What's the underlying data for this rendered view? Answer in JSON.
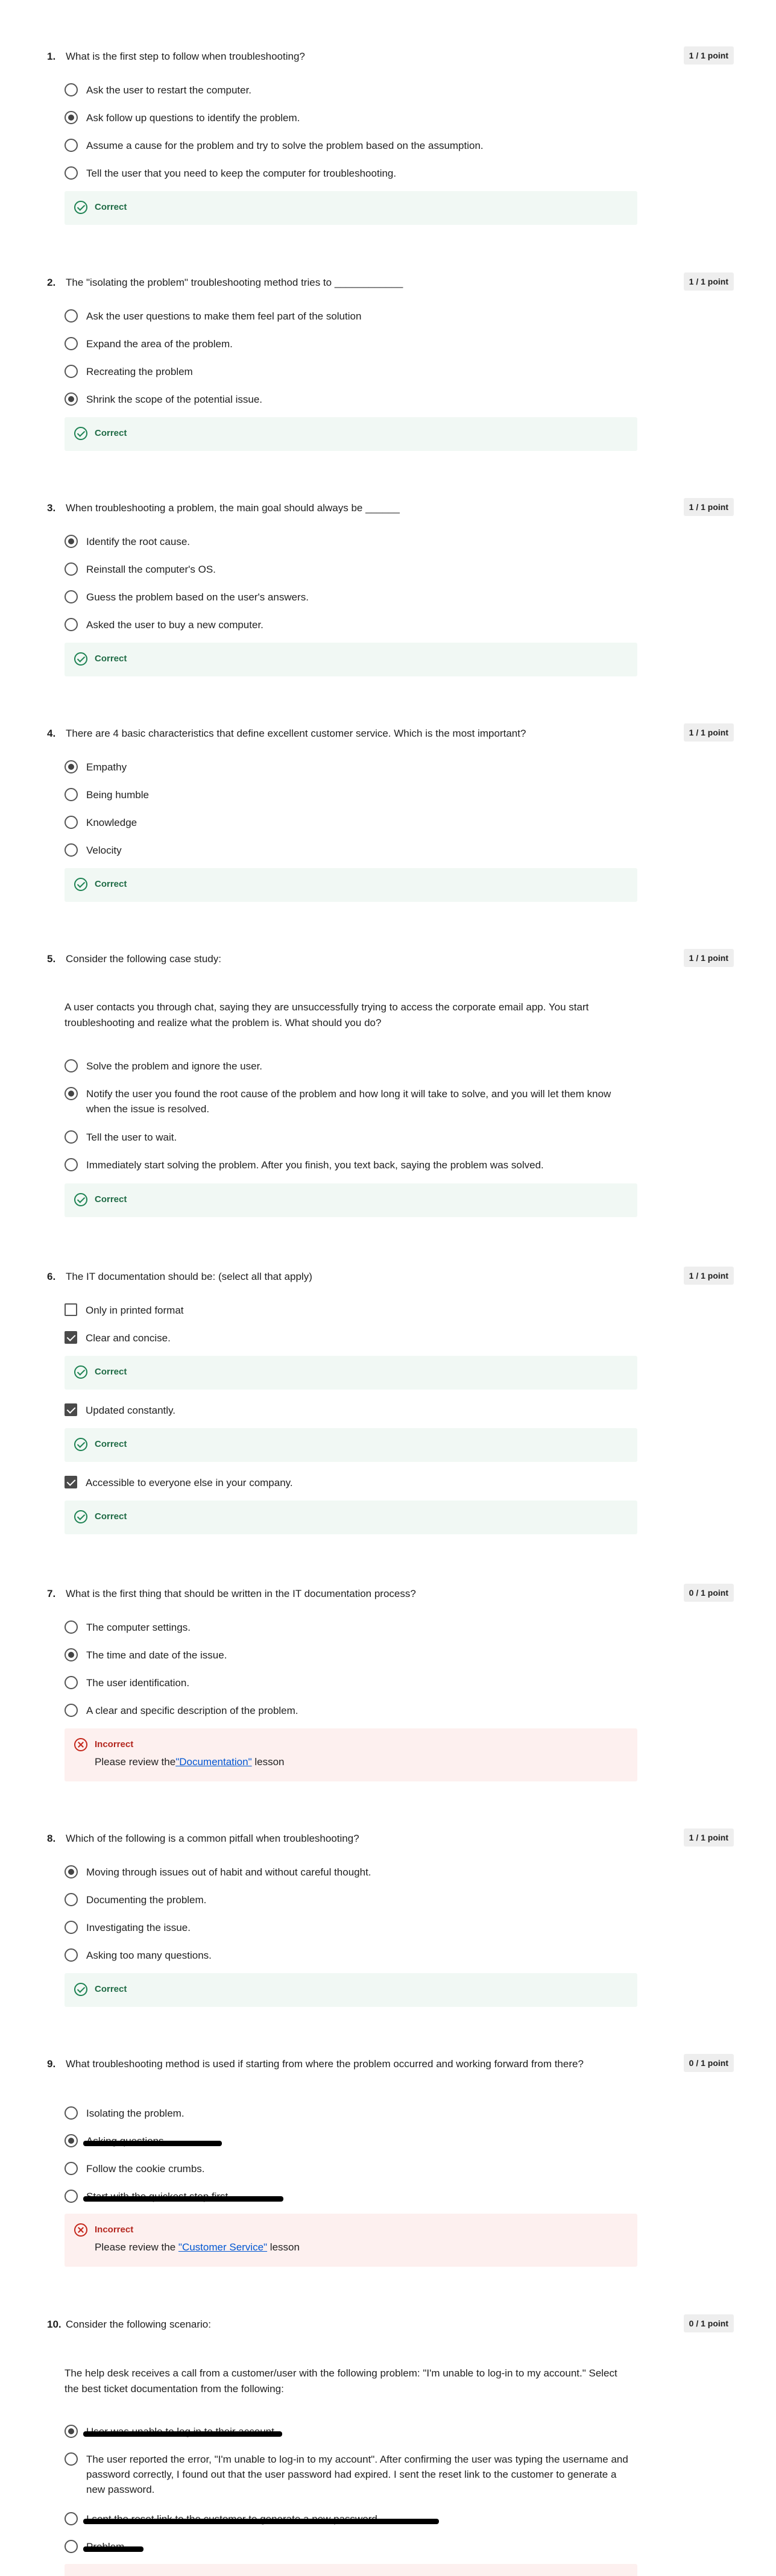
{
  "questions": [
    {
      "number": "1.",
      "text": "What is the first step to follow when troubleshooting?",
      "points": "1 / 1 point",
      "options": [
        {
          "label": "Ask the user to restart the computer.",
          "selected": false
        },
        {
          "label": "Ask follow up questions to identify the problem.",
          "selected": true
        },
        {
          "label": "Assume a cause for the problem and try to solve the problem based on the assumption.",
          "selected": false
        },
        {
          "label": "Tell the user that you need to keep the computer for troubleshooting.",
          "selected": false
        }
      ],
      "feedback": {
        "status": "Correct"
      }
    },
    {
      "number": "2.",
      "text": "The \"isolating the problem\" troubleshooting method tries to ____________",
      "points": "1 / 1 point",
      "options": [
        {
          "label": "Ask the user questions to make them feel part of the solution",
          "selected": false
        },
        {
          "label": "Expand the area of the problem.",
          "selected": false
        },
        {
          "label": "Recreating the problem",
          "selected": false
        },
        {
          "label": "Shrink the scope of the potential issue.",
          "selected": true
        }
      ],
      "feedback": {
        "status": "Correct"
      }
    },
    {
      "number": "3.",
      "text": "When troubleshooting a problem, the main goal should always be ______",
      "points": "1 / 1 point",
      "options": [
        {
          "label": "Identify the root cause.",
          "selected": true
        },
        {
          "label": "Reinstall the computer's OS.",
          "selected": false
        },
        {
          "label": "Guess the problem based on the user's answers.",
          "selected": false
        },
        {
          "label": "Asked the user to buy a new computer.",
          "selected": false
        }
      ],
      "feedback": {
        "status": "Correct"
      }
    },
    {
      "number": "4.",
      "text": "There are 4 basic characteristics that define excellent customer service. Which is the most important?",
      "points": "1 / 1 point",
      "options": [
        {
          "label": "Empathy",
          "selected": true
        },
        {
          "label": "Being humble",
          "selected": false
        },
        {
          "label": "Knowledge",
          "selected": false
        },
        {
          "label": "Velocity",
          "selected": false
        }
      ],
      "feedback": {
        "status": "Correct"
      }
    },
    {
      "number": "5.",
      "text": "Consider the following case study:",
      "points": "1 / 1 point",
      "case_text": "A user contacts you through chat, saying they are unsuccessfully trying to access the corporate email app. You start troubleshooting and realize what the problem is. What should you do?",
      "options": [
        {
          "label": "Solve the problem and ignore the user.",
          "selected": false
        },
        {
          "label": "Notify the user you found the root cause of the problem and how long it will take to solve, and you will let them know when the issue is resolved.",
          "selected": true
        },
        {
          "label": "Tell the user to wait.",
          "selected": false
        },
        {
          "label": "Immediately start solving the problem. After you finish, you text back, saying the problem was solved.",
          "selected": false
        }
      ],
      "feedback": {
        "status": "Correct"
      }
    },
    {
      "number": "6.",
      "text": "The IT documentation should be: (select all that apply)",
      "points": "1 / 1 point",
      "options": [
        {
          "label": "Only in printed format",
          "selected": false
        },
        {
          "label": "Clear and concise.",
          "selected": true,
          "feedback": "Correct"
        },
        {
          "label": "Updated constantly.",
          "selected": true,
          "feedback": "Correct"
        },
        {
          "label": "Accessible to everyone else in your company.",
          "selected": true,
          "feedback": "Correct"
        }
      ]
    },
    {
      "number": "7.",
      "text": "What is the first thing that should be written in the IT documentation process?",
      "points": "0 / 1 point",
      "options": [
        {
          "label": "The computer settings.",
          "selected": false
        },
        {
          "label": "The time and date of the issue.",
          "selected": true
        },
        {
          "label": "The user identification.",
          "selected": false
        },
        {
          "label": "A clear and specific description of the problem.",
          "selected": false
        }
      ],
      "feedback": {
        "status": "Incorrect",
        "note_prefix": "Please review the",
        "link": "\"Documentation\"",
        "note_suffix": " lesson"
      }
    },
    {
      "number": "8.",
      "text": "Which of the following is a common pitfall when troubleshooting?",
      "points": "1 / 1 point",
      "options": [
        {
          "label": "Moving through issues out of habit and without careful thought.",
          "selected": true
        },
        {
          "label": "Documenting the problem.",
          "selected": false
        },
        {
          "label": "Investigating the issue.",
          "selected": false
        },
        {
          "label": "Asking too many questions.",
          "selected": false
        }
      ],
      "feedback": {
        "status": "Correct"
      }
    },
    {
      "number": "9.",
      "text": "What troubleshooting method is used if starting from where the problem occurred and working forward from there?",
      "points": "0 / 1 point",
      "options": [
        {
          "label": "Isolating the problem.",
          "selected": false
        },
        {
          "label": "Asking questions",
          "selected": true
        },
        {
          "label": "Follow the cookie crumbs.",
          "selected": false
        },
        {
          "label": "Start with the quickest step first",
          "selected": false
        }
      ],
      "feedback": {
        "status": "Incorrect",
        "note_prefix": "Please review the ",
        "link": "\"Customer Service\"",
        "note_suffix": " lesson"
      }
    },
    {
      "number": "10.",
      "text": "Consider the following scenario:",
      "points": "0 / 1 point",
      "case_text": "The help desk receives a call from a customer/user with the following problem: \"I'm unable to log-in to my account.\" Select the best ticket documentation from the following:",
      "options": [
        {
          "label": "User was unable to log in to their account",
          "selected": true
        },
        {
          "label": "The user reported the error, \"I'm unable to log-in to my account\". After confirming the user was typing the username and password correctly, I found out that the user password had expired. I sent the reset link to the customer to generate a new password.",
          "selected": false
        },
        {
          "label": "I sent the reset link to the customer to generate a new password",
          "selected": false
        },
        {
          "label": "Problem",
          "selected": false
        }
      ]
    }
  ],
  "colors": {
    "correct": "#1f8354",
    "incorrect": "#c4281c",
    "link": "#0056d2"
  }
}
